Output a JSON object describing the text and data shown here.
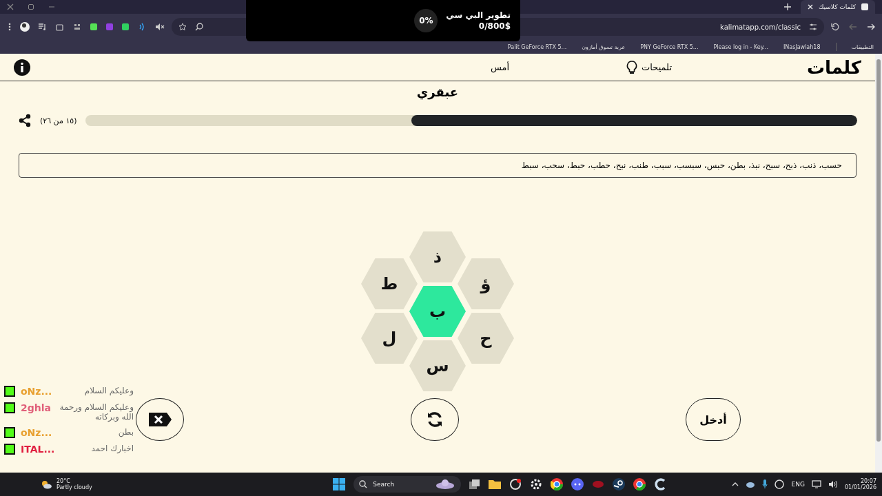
{
  "browser": {
    "tabs": [
      {
        "title": "كلمات كلاسيك",
        "selected": true
      }
    ],
    "url": "kalimatapp.com/classic",
    "bookmarks": [
      "التطبيقات",
      "INasJawlah18",
      "Please log in - Key...",
      "PNY GeForce RTX 5...",
      "عربة تسوق أمازون",
      "Palit GeForce RTX 5..."
    ]
  },
  "donation_goal": {
    "title": "تطوير البي سي",
    "amount": "0/800$",
    "percent": "0%"
  },
  "app": {
    "logo": "كلمات",
    "hints": "تلميحات",
    "yesterday": "أمس",
    "rank": "عبقري",
    "progress": {
      "count": "(١٥ من ٢٦)",
      "level": 0.577
    },
    "found_words": "حسب، ذنب، ذبح، سبح، نبذ، بطن، حبس، سبسب، سبب، طنب، نبح، حطب، حبط، سحب، سبط",
    "letters": [
      {
        "letter": "ذ",
        "kind": "outer"
      },
      {
        "letter": "ط",
        "kind": "outer"
      },
      {
        "letter": "ؤ",
        "kind": "outer"
      },
      {
        "letter": "ب",
        "kind": "center"
      },
      {
        "letter": "ل",
        "kind": "outer"
      },
      {
        "letter": "ح",
        "kind": "outer"
      },
      {
        "letter": "س",
        "kind": "outer"
      }
    ],
    "enter": "أدخل"
  },
  "chat": [
    {
      "name": "oNz...",
      "color": "#e8a030",
      "text": "وعليكم السلام"
    },
    {
      "name": "2ghla",
      "color": "#e0607a",
      "text": "وعليكم السلام ورحمة الله وبركاته"
    },
    {
      "name": "oNz...",
      "color": "#e8a030",
      "text": "بطن"
    },
    {
      "name": "ITAL...",
      "color": "#e02040",
      "text": "اخبارك احمد"
    }
  ],
  "taskbar": {
    "weather": {
      "temp": "20°C",
      "condition": "Partly cloudy"
    },
    "search": "Search",
    "language": "ENG",
    "time": "20:07",
    "date": "01/01/2026"
  }
}
